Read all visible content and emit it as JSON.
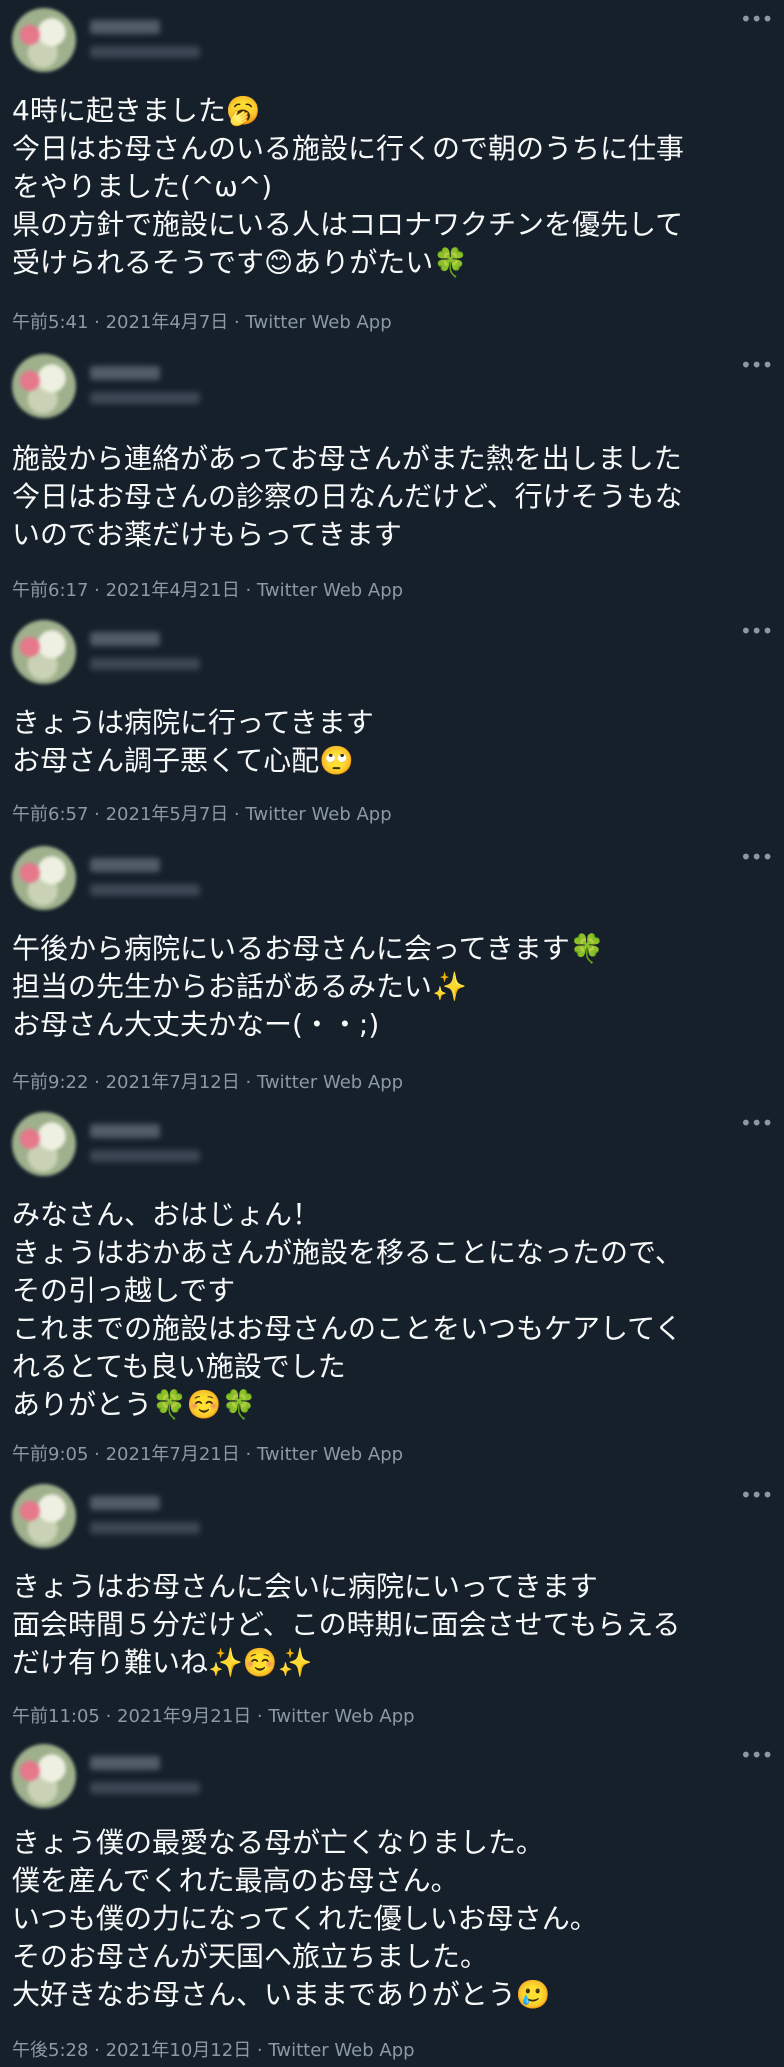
{
  "tweets": [
    {
      "lines": [
        "4時に起きました🥱",
        "今日はお母さんのいる施設に行くので朝のうちに仕事",
        "をやりました(^ω^)",
        "県の方針で施設にいる人はコロナワクチンを優先して",
        "受けられるそうです😊ありがたい🍀"
      ],
      "meta": "午前5:41 · 2021年4月7日 · Twitter Web App"
    },
    {
      "lines": [
        "施設から連絡があってお母さんがまた熱を出しました",
        "今日はお母さんの診察の日なんだけど、行けそうもな",
        "いのでお薬だけもらってきます"
      ],
      "meta": "午前6:17 · 2021年4月21日 · Twitter Web App"
    },
    {
      "lines": [
        "きょうは病院に行ってきます",
        "お母さん調子悪くて心配🙄"
      ],
      "meta": "午前6:57 · 2021年5月7日 · Twitter Web App"
    },
    {
      "lines": [
        "午後から病院にいるお母さんに会ってきます🍀",
        "担当の先生からお話があるみたい✨",
        "お母さん大丈夫かなー(・・;)"
      ],
      "meta": "午前9:22 · 2021年7月12日 · Twitter Web App"
    },
    {
      "lines": [
        "みなさん、おはじょん！",
        "きょうはおかあさんが施設を移ることになったので、",
        "その引っ越しです",
        "これまでの施設はお母さんのことをいつもケアしてく",
        "れるとても良い施設でした",
        "ありがとう🍀☺️🍀"
      ],
      "meta": "午前9:05 · 2021年7月21日 · Twitter Web App"
    },
    {
      "lines": [
        "きょうはお母さんに会いに病院にいってきます",
        "面会時間５分だけど、この時期に面会させてもらえる",
        "だけ有り難いね✨☺️✨"
      ],
      "meta": "午前11:05 · 2021年9月21日 · Twitter Web App"
    },
    {
      "lines": [
        "きょう僕の最愛なる母が亡くなりました。",
        "僕を産んでくれた最高のお母さん。",
        "いつも僕の力になってくれた優しいお母さん。",
        "そのお母さんが天国へ旅立ちました。",
        "大好きなお母さん、いままでありがとう🥲"
      ],
      "meta": "午後5:28 · 2021年10月12日 · Twitter Web App"
    }
  ],
  "more_icon": "more-horizontal-icon",
  "colors": {
    "background": "#15202b",
    "text": "#f7f9f9",
    "muted": "#8b98a5"
  }
}
